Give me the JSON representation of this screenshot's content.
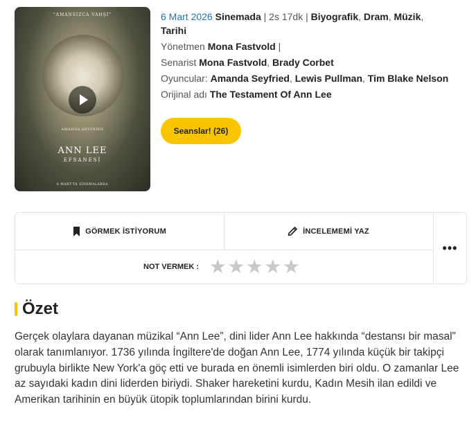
{
  "poster": {
    "tagline": "\"AMANSIZCA VAHŞİ\"",
    "actor": "AMANDA SEYFRIED",
    "title": "ANN LEE",
    "subtitle": "EFSANESİ",
    "release": "6 MART'TA SİNEMALARDA"
  },
  "movie": {
    "release_date": "6 Mart 2026",
    "release_place": "Sinemada",
    "sep1": " | ",
    "duration": "2s 17dk",
    "sep2": " | ",
    "genres": [
      "Biyografik",
      "Dram",
      "Müzik",
      "Tarihi"
    ],
    "director_label": "Yönetmen",
    "director": "Mona Fastvold",
    "director_sep": " |",
    "writer_label": "Senarist",
    "writers": [
      "Mona Fastvold",
      "Brady Corbet"
    ],
    "cast_label": "Oyuncular:",
    "cast": [
      "Amanda Seyfried",
      "Lewis Pullman",
      "Tim Blake Nelson"
    ],
    "original_label": "Orijinal adı",
    "original_title": "The Testament Of Ann Lee"
  },
  "sessions_button": "Seanslar! (26)",
  "actions": {
    "want_label": "GÖRMEK İSTİYORUM",
    "review_label": "İNCELEMEMİ YAZ",
    "more_label": "•••",
    "rate_label": "NOT VERMEK :",
    "stars_total": 5,
    "stars_selected": 0
  },
  "summary": {
    "title": "Özet",
    "text": "Gerçek olaylara dayanan müzikal “Ann Lee”, dini lider Ann Lee hakkında “destansı bir masal” olarak tanımlanıyor. 1736 yılında İngiltere'de doğan Ann Lee, 1774 yılında küçük bir takipçi grubuyla birlikte New York'a göç etti ve burada en önemli isimlerden biri oldu. O zamanlar Lee az sayıdaki kadın dini liderden biriydi. Shaker hareketini kurdu, Kadın Mesih ilan edildi ve Amerikan tarihinin en büyük ütopik toplumlarından birini kurdu."
  },
  "colors": {
    "accent": "#f9c400",
    "link": "#1a73c7",
    "star_empty": "#c8c8c8"
  }
}
